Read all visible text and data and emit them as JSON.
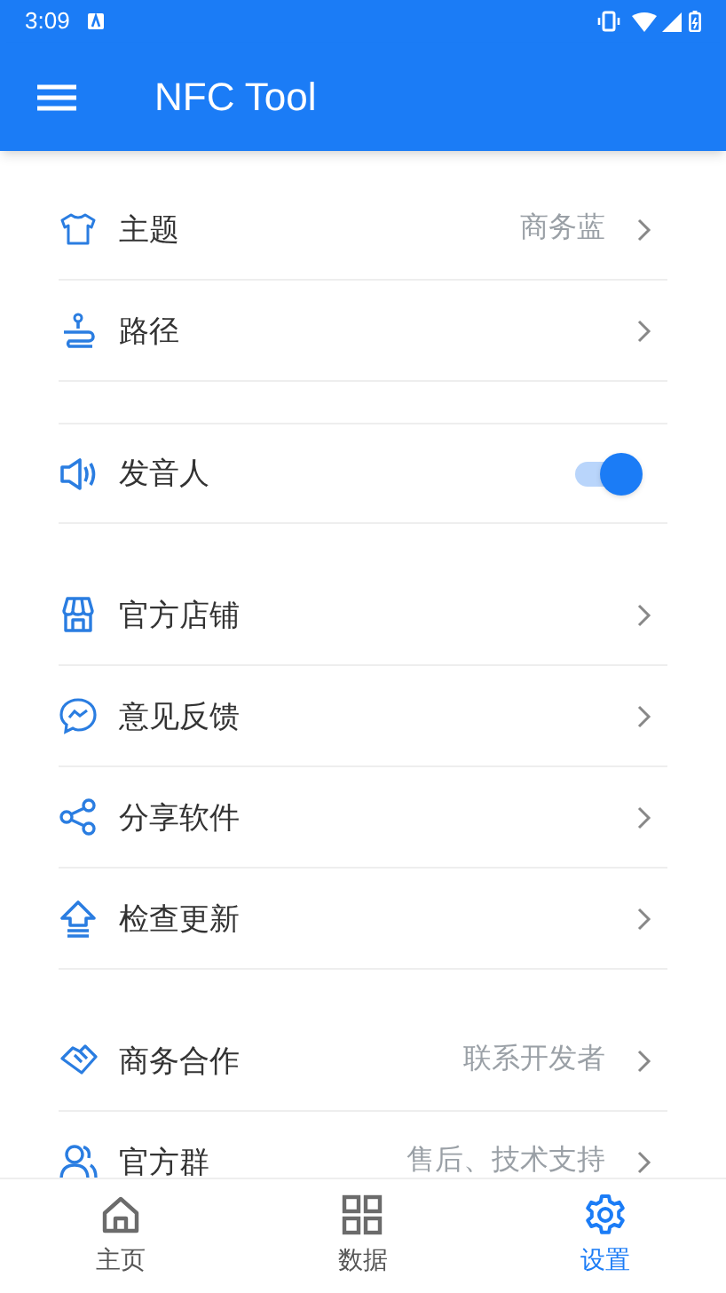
{
  "status_bar": {
    "time": "3:09"
  },
  "app_bar": {
    "title": "NFC Tool"
  },
  "groups": [
    {
      "items": [
        {
          "kind": "link",
          "label": "主题",
          "value": "商务蓝"
        },
        {
          "kind": "link",
          "label": "路径"
        }
      ]
    },
    {
      "items": [
        {
          "kind": "toggle",
          "label": "发音人",
          "on": true
        }
      ]
    },
    {
      "items": [
        {
          "kind": "link",
          "label": "官方店铺"
        },
        {
          "kind": "link",
          "label": "意见反馈"
        },
        {
          "kind": "link",
          "label": "分享软件"
        },
        {
          "kind": "link",
          "label": "检查更新"
        }
      ]
    },
    {
      "items": [
        {
          "kind": "link",
          "label": "商务合作",
          "value": "联系开发者"
        },
        {
          "kind": "link",
          "label": "官方群",
          "value": "售后、技术支持"
        }
      ]
    }
  ],
  "bottom_nav": [
    {
      "label": "主页",
      "selected": false
    },
    {
      "label": "数据",
      "selected": false
    },
    {
      "label": "设置",
      "selected": true
    }
  ]
}
